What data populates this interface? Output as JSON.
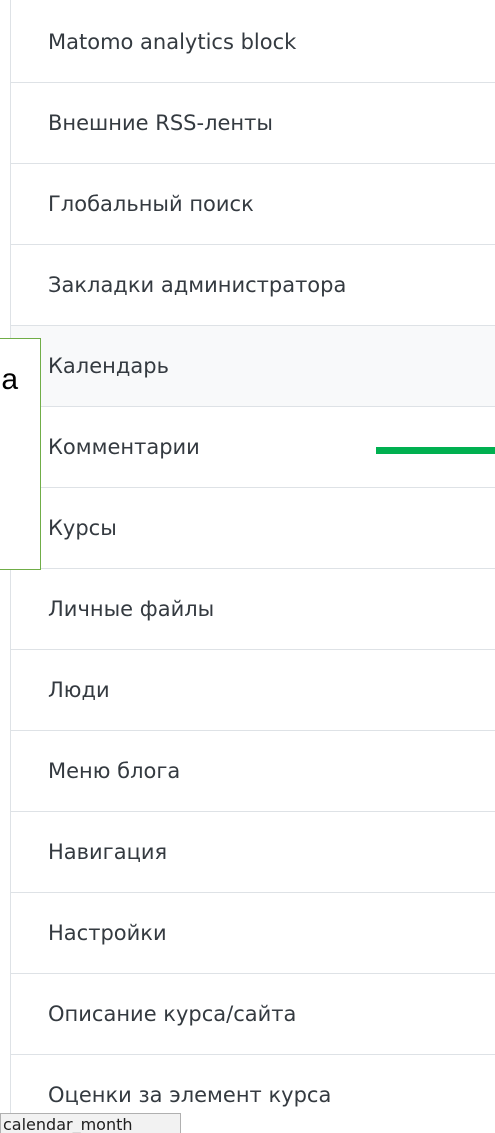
{
  "menu": {
    "items": [
      {
        "label": "Matomo analytics block"
      },
      {
        "label": "Внешние RSS-ленты"
      },
      {
        "label": "Глобальный поиск"
      },
      {
        "label": "Закладки администратора"
      },
      {
        "label": "Календарь"
      },
      {
        "label": "Комментарии"
      },
      {
        "label": "Курсы"
      },
      {
        "label": "Личные файлы"
      },
      {
        "label": "Люди"
      },
      {
        "label": "Меню блога"
      },
      {
        "label": "Навигация"
      },
      {
        "label": "Настройки"
      },
      {
        "label": "Описание курса/сайта"
      },
      {
        "label": "Оценки за элемент курса"
      }
    ]
  },
  "callout": {
    "text": "а"
  },
  "tooltip": {
    "text": "calendar_month"
  },
  "colors": {
    "callout_border": "#70ad47",
    "pointer_line": "#00b050",
    "divider": "#dee2e6",
    "text": "#343a40"
  }
}
